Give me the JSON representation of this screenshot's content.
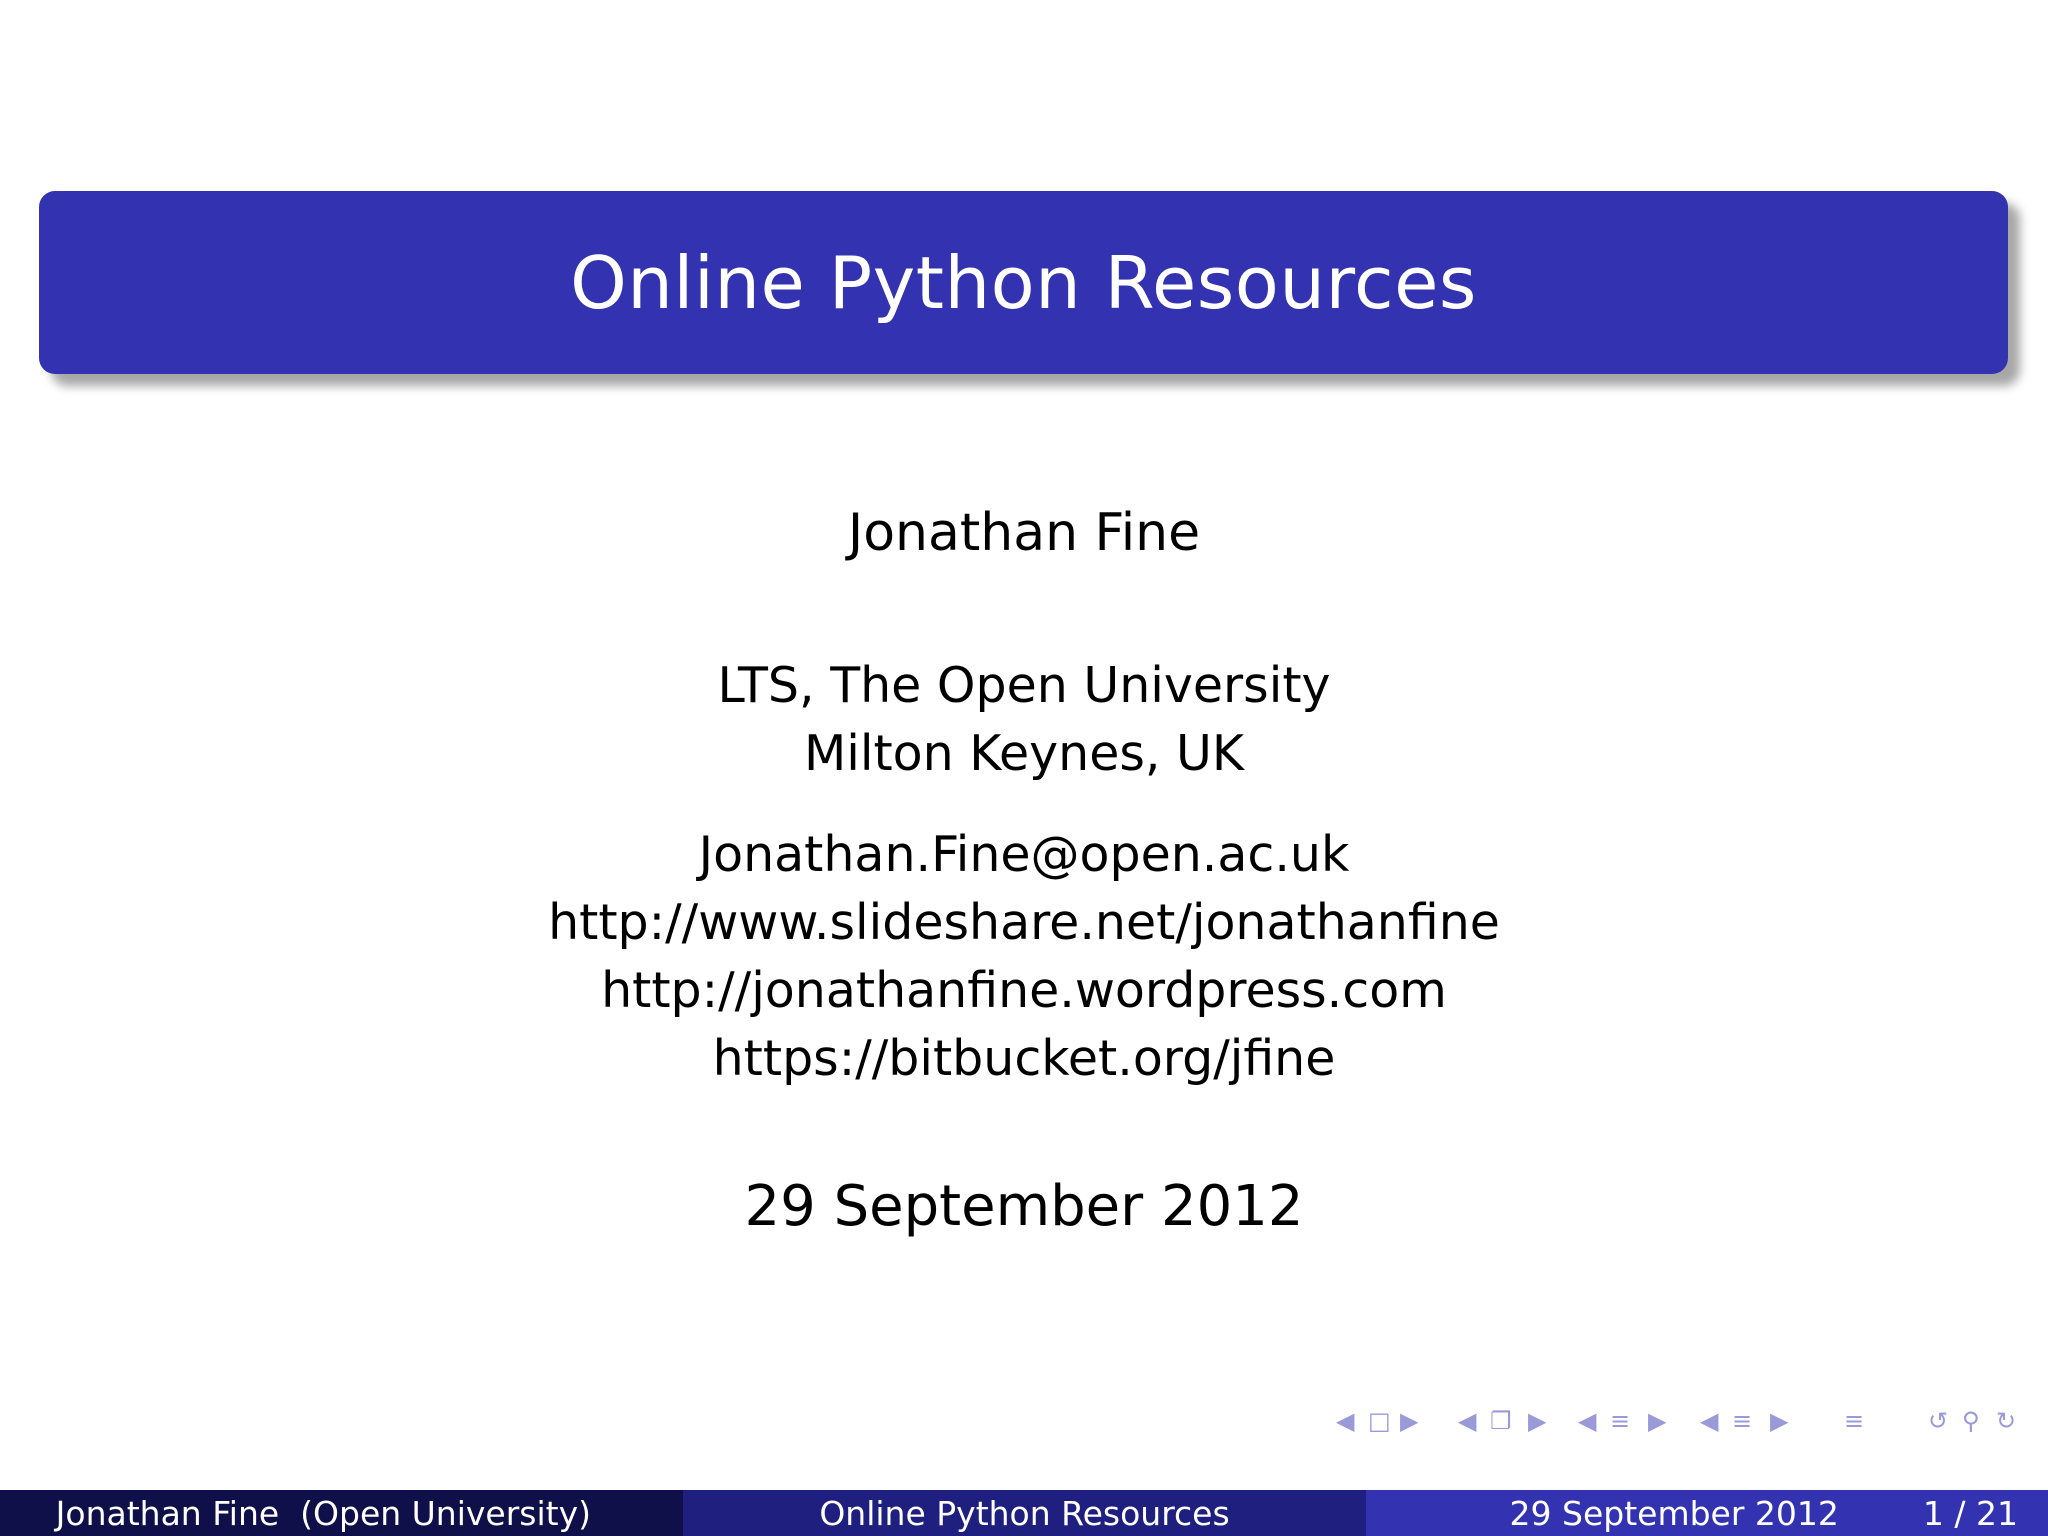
{
  "slide": {
    "title": "Online Python Resources",
    "author": "Jonathan Fine",
    "institution": [
      "LTS, The Open University",
      "Milton Keynes, UK"
    ],
    "contact": [
      "Jonathan.Fine@open.ac.uk",
      "http://www.slideshare.net/jonathanfine",
      "http://jonathanfine.wordpress.com",
      "https://bitbucket.org/jfine"
    ],
    "date": "29 September 2012"
  },
  "footer": {
    "author_short": "Jonathan Fine  (Open University)",
    "title_short": "Online Python Resources",
    "date": "29 September 2012",
    "page": "1 / 21"
  },
  "colors": {
    "title_bar": "#3333b2",
    "footer_dark": "#0f0f4a",
    "footer_mid": "#1f1f7f",
    "footer_light": "#3333b2",
    "nav_icons": "#9a9ad8"
  },
  "nav_icons": [
    "arrow-left-icon",
    "frame-icon",
    "arrow-right-icon",
    "arrow-left-icon",
    "subsection-icon",
    "arrow-right-icon",
    "arrow-left-icon",
    "section-icon",
    "arrow-right-icon",
    "arrow-left-icon",
    "subsection-list-icon",
    "arrow-right-icon",
    "align-icon",
    "undo-icon",
    "search-icon",
    "redo-icon"
  ]
}
